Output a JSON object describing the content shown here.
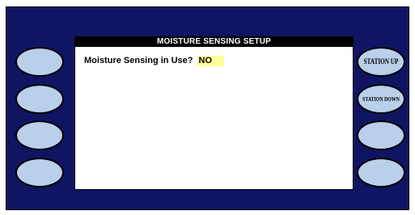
{
  "screen": {
    "title": "MOISTURE SENSING SETUP",
    "field": {
      "label": "Moisture Sensing in Use?",
      "value": "NO"
    }
  },
  "softkeys": {
    "left": [
      "",
      "",
      "",
      ""
    ],
    "right": [
      "STATION UP",
      "STATION DOWN",
      "",
      ""
    ]
  },
  "colors": {
    "panel": "#0f1463",
    "softkey": "#b9cfea",
    "field_highlight": "#ffff99",
    "title_bar": "#000000"
  }
}
